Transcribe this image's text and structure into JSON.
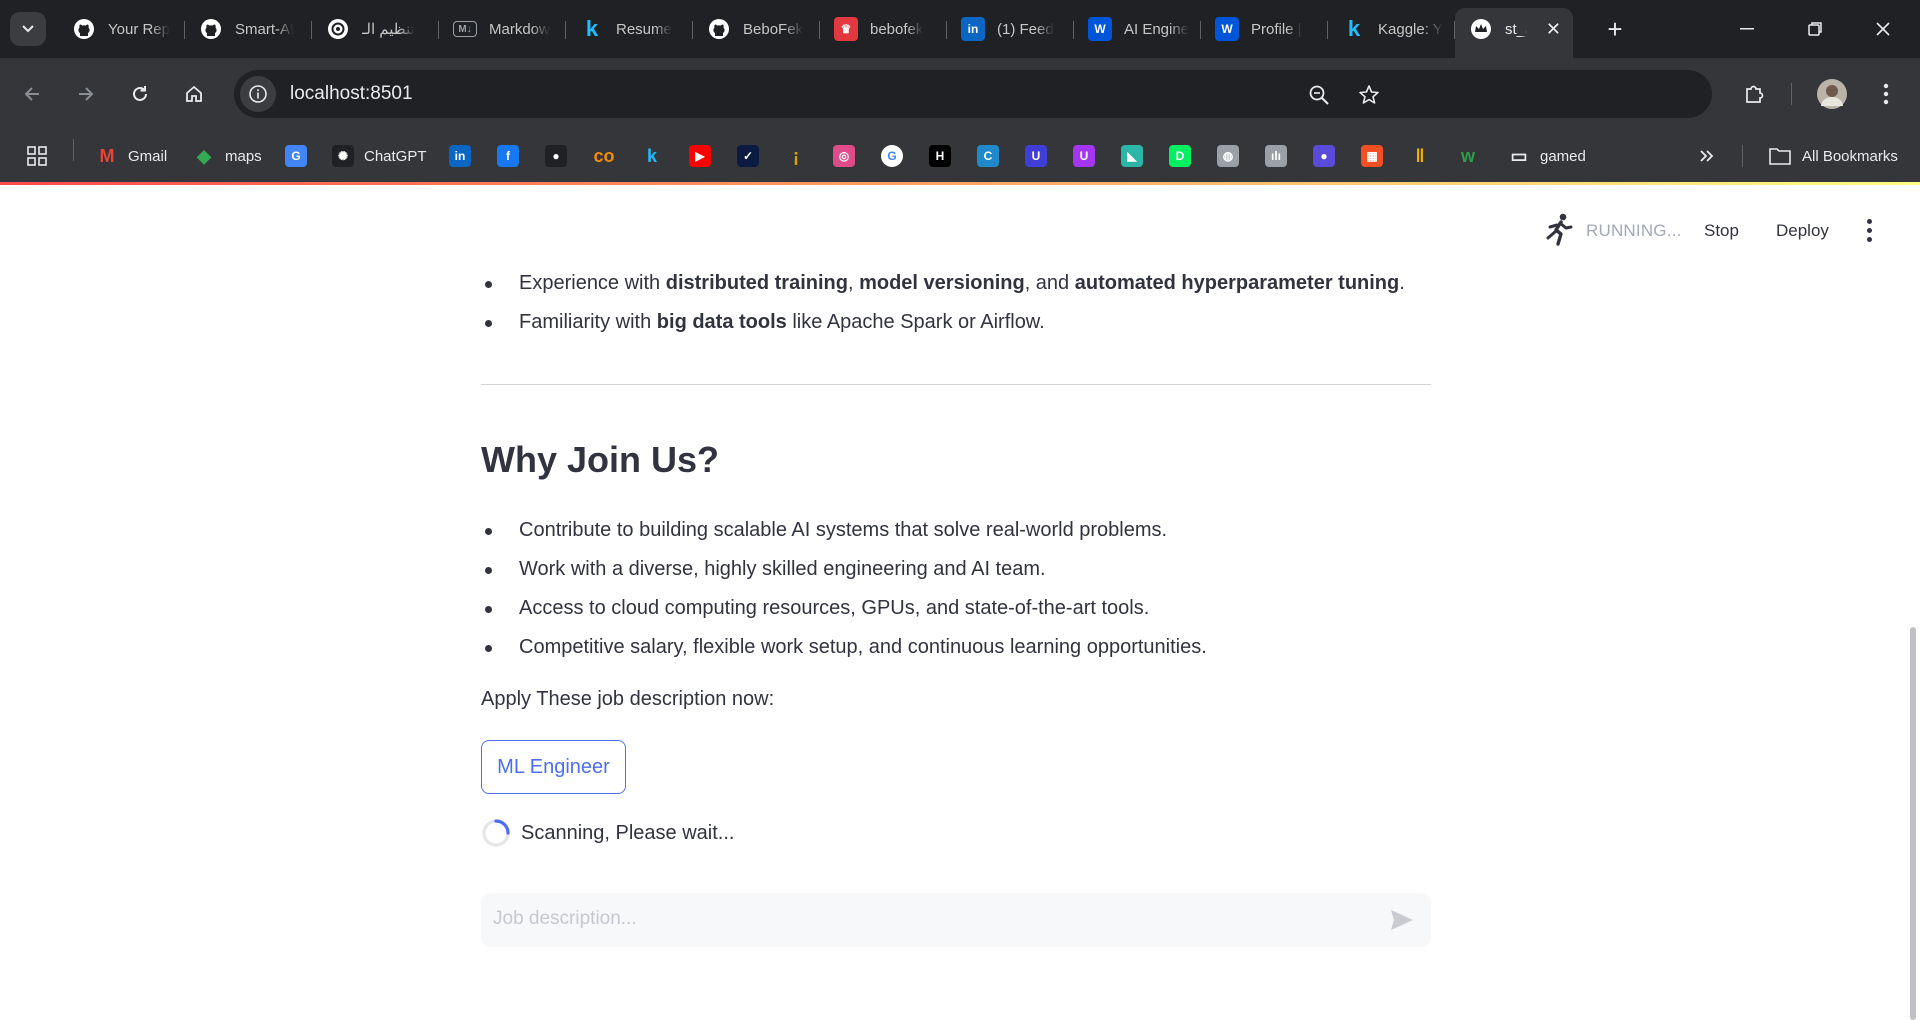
{
  "browser": {
    "tabs": [
      {
        "title": "Your Rep",
        "icon": "github-icon",
        "color": "#ffffff"
      },
      {
        "title": "Smart-AI",
        "icon": "github-icon",
        "color": "#ffffff"
      },
      {
        "title": "تنظيم الـ",
        "icon": "chatgpt-icon",
        "color": "#ffffff"
      },
      {
        "title": "Markdow",
        "icon": "markdown-icon",
        "color": "#9aa0a6"
      },
      {
        "title": "Resume",
        "icon": "kaggle-icon",
        "color": "#20beff"
      },
      {
        "title": "BeboFek",
        "icon": "github-icon",
        "color": "#ffffff"
      },
      {
        "title": "bebofek",
        "icon": "crown-icon",
        "color": "#e2383f"
      },
      {
        "title": "(1) Feed",
        "icon": "linkedin-icon",
        "color": "#0a66c2"
      },
      {
        "title": "AI Engine",
        "icon": "wuzzuf-icon",
        "color": "#0055d9"
      },
      {
        "title": "Profile |",
        "icon": "wuzzuf-icon",
        "color": "#0055d9"
      },
      {
        "title": "Kaggle: Y",
        "icon": "kaggle-icon",
        "color": "#20beff"
      }
    ],
    "active_tab": {
      "title": "st_app",
      "icon": "streamlit-crown-icon"
    },
    "url": "localhost:8501",
    "bookmarks": [
      {
        "label": "Gmail",
        "icon": "gmail-icon",
        "color": "#ea4335"
      },
      {
        "label": "maps",
        "icon": "maps-icon",
        "color": "#34a853"
      },
      {
        "label": "",
        "icon": "google-translate-icon",
        "color": "#4285f4"
      },
      {
        "label": "ChatGPT",
        "icon": "chatgpt-icon",
        "color": "#202124"
      },
      {
        "label": "",
        "icon": "linkedin-icon",
        "color": "#0a66c2"
      },
      {
        "label": "",
        "icon": "facebook-icon",
        "color": "#1877f2"
      },
      {
        "label": "",
        "icon": "github-icon",
        "color": "#202124"
      },
      {
        "label": "",
        "icon": "coursera-icon",
        "color": "#f28c00"
      },
      {
        "label": "",
        "icon": "kaggle-icon",
        "color": "#20beff"
      },
      {
        "label": "",
        "icon": "youtube-icon",
        "color": "#ff0000"
      },
      {
        "label": "",
        "icon": "checkmark-icon",
        "color": "#0b1b3f"
      },
      {
        "label": "",
        "icon": "torch-icon",
        "color": "#d9a400"
      },
      {
        "label": "",
        "icon": "swirl-icon",
        "color": "#e04b8a"
      },
      {
        "label": "",
        "icon": "google-icon",
        "color": "#ffffff"
      },
      {
        "label": "",
        "icon": "hackerrank-icon",
        "color": "#000000"
      },
      {
        "label": "",
        "icon": "codeforces-icon",
        "color": "#1f8acb"
      },
      {
        "label": "",
        "icon": "udacity-icon",
        "color": "#3f3fd8"
      },
      {
        "label": "",
        "icon": "udemy-icon",
        "color": "#a435f0"
      },
      {
        "label": "",
        "icon": "frontend-mentor-icon",
        "color": "#2bb6a8"
      },
      {
        "label": "",
        "icon": "datacamp-icon",
        "color": "#03ef62"
      },
      {
        "label": "",
        "icon": "globe-icon",
        "color": "#9aa0a6"
      },
      {
        "label": "",
        "icon": "cisco-icon",
        "color": "#9aa0a6"
      },
      {
        "label": "",
        "icon": "blob-icon",
        "color": "#5b4bdb"
      },
      {
        "label": "",
        "icon": "microsoft-icon",
        "color": "#f25022"
      },
      {
        "label": "",
        "icon": "bars-icon",
        "color": "#f4b400"
      },
      {
        "label": "",
        "icon": "wuzzuf-w-icon",
        "color": "#2e9d4a"
      },
      {
        "label": "gamed",
        "icon": "page-icon",
        "color": "#e8eaed"
      }
    ],
    "all_bookmarks_label": "All Bookmarks"
  },
  "app": {
    "status": "RUNNING...",
    "stop_label": "Stop",
    "deploy_label": "Deploy",
    "requirements": [
      [
        {
          "t": "Experience with ",
          "b": false
        },
        {
          "t": "distributed training",
          "b": true
        },
        {
          "t": ", ",
          "b": false
        },
        {
          "t": "model versioning",
          "b": true
        },
        {
          "t": ", and ",
          "b": false
        },
        {
          "t": "automated hyperparameter tuning",
          "b": true
        },
        {
          "t": ".",
          "b": false
        }
      ],
      [
        {
          "t": "Familiarity with ",
          "b": false
        },
        {
          "t": "big data tools",
          "b": true
        },
        {
          "t": " like Apache Spark or Airflow.",
          "b": false
        }
      ]
    ],
    "why_heading": "Why Join Us?",
    "why_items": [
      "Contribute to building scalable AI systems that solve real-world problems.",
      "Work with a diverse, highly skilled engineering and AI team.",
      "Access to cloud computing resources, GPUs, and state-of-the-art tools.",
      "Competitive salary, flexible work setup, and continuous learning opportunities."
    ],
    "apply_text": "Apply These job description now:",
    "button_label": "ML Engineer",
    "scanning_text": "Scanning, Please wait...",
    "chat_placeholder": "Job description...",
    "accent_color": "#4e6ef2"
  }
}
